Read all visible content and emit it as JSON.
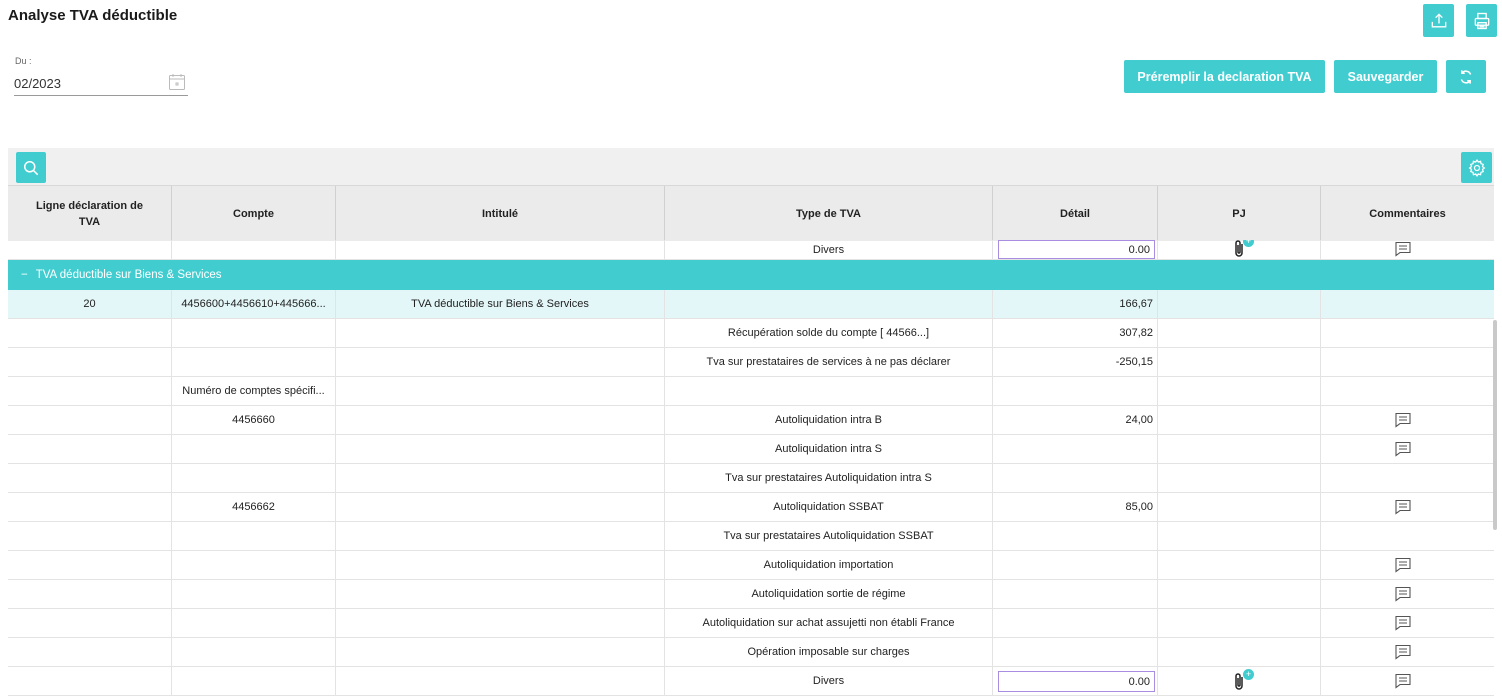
{
  "page": {
    "title": "Analyse TVA déductible"
  },
  "colors": {
    "accent": "#41cdd0",
    "highlight_row": "#e4f7f8",
    "input_border": "#a98de0"
  },
  "filters": {
    "date_label": "Du :",
    "date_value": "02/2023"
  },
  "actions": {
    "prefill_label": "Préremplir la declaration TVA",
    "save_label": "Sauvegarder",
    "refresh_icon": "refresh-icon",
    "export_icon": "upload-icon",
    "print_icon": "printer-icon"
  },
  "table": {
    "headers": [
      "Ligne déclaration de TVA",
      "Compte",
      "Intitulé",
      "Type de TVA",
      "Détail",
      "PJ",
      "Commentaires"
    ],
    "group_label": "TVA déductible sur Biens & Services",
    "group_toggle": "−",
    "rows": [
      {
        "ligne": "",
        "compte": "",
        "intitule": "",
        "type": "Divers",
        "detail": "0.00",
        "detail_input": true,
        "pj": true,
        "pj_badge": true,
        "comment": true
      },
      {
        "group": true
      },
      {
        "ligne": "20",
        "compte": "4456600+4456610+445666...",
        "intitule": "TVA déductible sur Biens & Services",
        "type": "",
        "detail": "166,67",
        "pj": false,
        "comment": false,
        "highlight": true
      },
      {
        "ligne": "",
        "compte": "",
        "intitule": "",
        "type": "Récupération solde du compte [ 44566...]",
        "detail": "307,82",
        "pj": false,
        "comment": false
      },
      {
        "ligne": "",
        "compte": "",
        "intitule": "",
        "type": "Tva sur prestataires de services à ne pas déclarer",
        "detail": "-250,15",
        "pj": false,
        "comment": false
      },
      {
        "ligne": "",
        "compte": "Numéro de comptes spécifi...",
        "intitule": "",
        "type": "",
        "detail": "",
        "pj": false,
        "comment": false
      },
      {
        "ligne": "",
        "compte": "4456660",
        "intitule": "",
        "type": "Autoliquidation intra B",
        "detail": "24,00",
        "pj": false,
        "comment": true
      },
      {
        "ligne": "",
        "compte": "",
        "intitule": "",
        "type": "Autoliquidation intra S",
        "detail": "",
        "pj": false,
        "comment": true
      },
      {
        "ligne": "",
        "compte": "",
        "intitule": "",
        "type": "Tva sur prestataires Autoliquidation intra S",
        "detail": "",
        "pj": false,
        "comment": false
      },
      {
        "ligne": "",
        "compte": "4456662",
        "intitule": "",
        "type": "Autoliquidation SSBAT",
        "detail": "85,00",
        "pj": false,
        "comment": true
      },
      {
        "ligne": "",
        "compte": "",
        "intitule": "",
        "type": "Tva sur prestataires Autoliquidation SSBAT",
        "detail": "",
        "pj": false,
        "comment": false
      },
      {
        "ligne": "",
        "compte": "",
        "intitule": "",
        "type": "Autoliquidation importation",
        "detail": "",
        "pj": false,
        "comment": true
      },
      {
        "ligne": "",
        "compte": "",
        "intitule": "",
        "type": "Autoliquidation sortie de régime",
        "detail": "",
        "pj": false,
        "comment": true
      },
      {
        "ligne": "",
        "compte": "",
        "intitule": "",
        "type": "Autoliquidation sur achat assujetti non établi France",
        "detail": "",
        "pj": false,
        "comment": true
      },
      {
        "ligne": "",
        "compte": "",
        "intitule": "",
        "type": "Opération imposable sur charges",
        "detail": "",
        "pj": false,
        "comment": true
      },
      {
        "ligne": "",
        "compte": "",
        "intitule": "",
        "type": "Divers",
        "detail": "0.00",
        "detail_input": true,
        "pj": true,
        "pj_badge": true,
        "comment": true
      }
    ]
  }
}
